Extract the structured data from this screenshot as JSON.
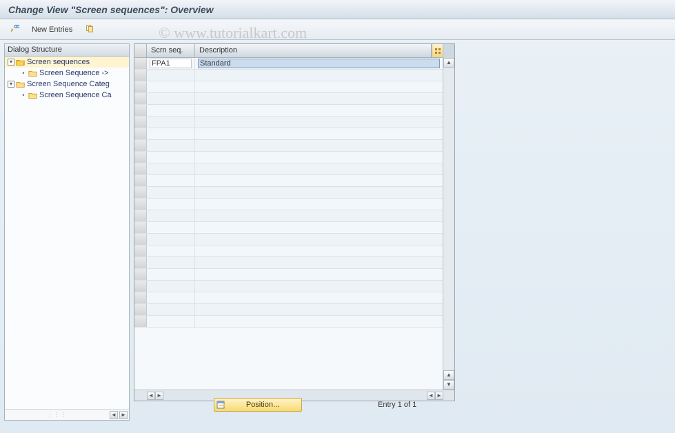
{
  "title": "Change View \"Screen sequences\": Overview",
  "watermark": "© www.tutorialkart.com",
  "toolbar": {
    "new_entries_label": "New Entries"
  },
  "tree": {
    "header": "Dialog Structure",
    "nodes": [
      {
        "label": "Screen sequences",
        "selected": true,
        "open": true,
        "indent": 0
      },
      {
        "label": "Screen Sequence ->",
        "selected": false,
        "open": false,
        "indent": 1,
        "leaf": true
      },
      {
        "label": "Screen Sequence Categ",
        "selected": false,
        "open": false,
        "indent": 0
      },
      {
        "label": "Screen Sequence Ca",
        "selected": false,
        "open": false,
        "indent": 1,
        "leaf": true
      }
    ]
  },
  "table": {
    "columns": {
      "scrn": "Scrn seq.",
      "desc": "Description"
    },
    "rows": [
      {
        "scrn": "FPA1",
        "desc": "Standard"
      }
    ],
    "empty_rows": 22
  },
  "footer": {
    "position_label": "Position...",
    "entry_text": "Entry 1 of 1"
  }
}
